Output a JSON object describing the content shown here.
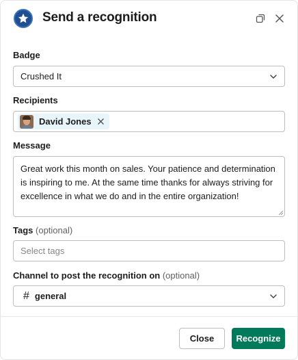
{
  "modal": {
    "title": "Send a recognition",
    "icons": {
      "app": "star-badge-icon",
      "expand": "expand-icon",
      "close": "close-icon"
    }
  },
  "form": {
    "badge": {
      "label": "Badge",
      "value": "Crushed It"
    },
    "recipients": {
      "label": "Recipients",
      "items": [
        {
          "name": "David Jones"
        }
      ]
    },
    "message": {
      "label": "Message",
      "value": "Great work this month on sales. Your patience and determination is inspiring to me. At the same time thanks for always striving for excellence in what we do and in the entire organization!"
    },
    "tags": {
      "label": "Tags",
      "optional": "(optional)",
      "placeholder": "Select tags"
    },
    "channel": {
      "label": "Channel to post the recognition on",
      "optional": "(optional)",
      "value": "general",
      "prefix": "#"
    }
  },
  "footer": {
    "close_label": "Close",
    "submit_label": "Recognize"
  },
  "colors": {
    "primary": "#007a5a",
    "chip_bg": "#e8f5fa",
    "logo": "#1f4f8f"
  }
}
